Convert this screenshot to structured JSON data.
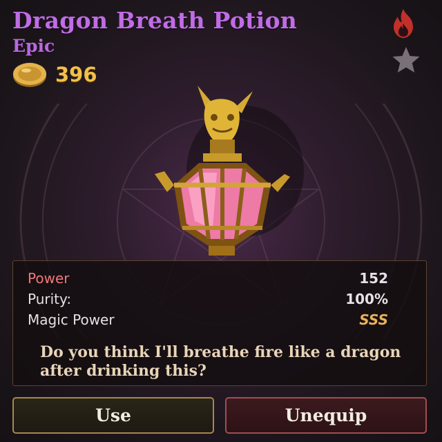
{
  "item": {
    "name": "Dragon Breath Potion",
    "rarity": "Epic",
    "price": "396"
  },
  "icons": {
    "currency": "gold-coin-icon",
    "element": "fire-icon",
    "favorite": "star-icon"
  },
  "stats": [
    {
      "label": "Power",
      "value": "152"
    },
    {
      "label": "Purity:",
      "value": "100%"
    },
    {
      "label": "Magic Power",
      "value": "SSS"
    }
  ],
  "description": "Do you think I'll breathe fire like a dragon after drinking this?",
  "buttons": {
    "use": "Use",
    "unequip": "Unequip"
  },
  "colors": {
    "title": "#c06ce6",
    "rarity": "#b968e0",
    "coin": "#f1c04a",
    "power_label": "#f07878",
    "grade": "#e9b25a",
    "use_border": "#a8884e",
    "unequip_border": "#a34d52"
  }
}
